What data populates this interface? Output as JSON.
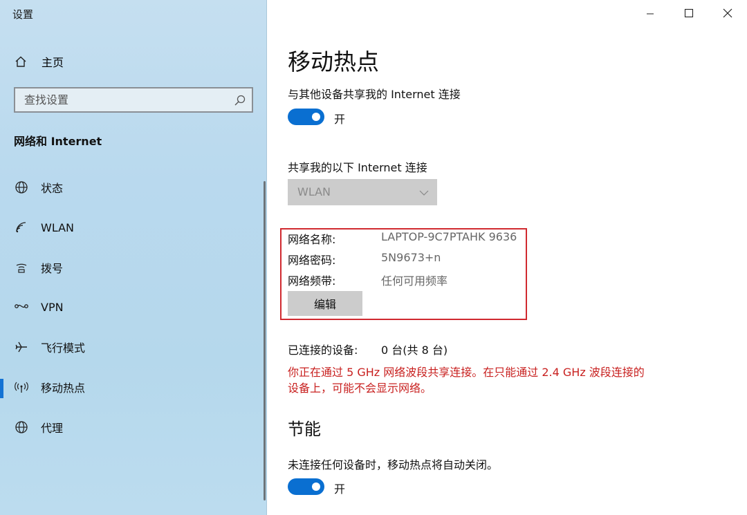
{
  "window": {
    "title": "设置",
    "controls": {
      "minimize": "minimize-icon",
      "maximize": "maximize-icon",
      "close": "close-icon"
    }
  },
  "sidebar": {
    "home_label": "主页",
    "search_placeholder": "查找设置",
    "section_title": "网络和 Internet",
    "items": [
      {
        "label": "状态",
        "icon": "globe-status-icon"
      },
      {
        "label": "WLAN",
        "icon": "wifi-icon"
      },
      {
        "label": "拨号",
        "icon": "dialup-icon"
      },
      {
        "label": "VPN",
        "icon": "vpn-icon"
      },
      {
        "label": "飞行模式",
        "icon": "airplane-icon"
      },
      {
        "label": "移动热点",
        "icon": "hotspot-icon",
        "selected": true
      },
      {
        "label": "代理",
        "icon": "globe-icon"
      }
    ]
  },
  "main": {
    "title": "移动热点",
    "share_label": "与其他设备共享我的 Internet 连接",
    "share_toggle_state": "开",
    "share_from_label": "共享我的以下 Internet 连接",
    "share_from_value": "WLAN",
    "network_name_label": "网络名称:",
    "network_name_value": "LAPTOP-9C7PTAHK 9636",
    "network_password_label": "网络密码:",
    "network_password_value": "5N9673+n",
    "network_band_label": "网络频带:",
    "network_band_value": "任何可用频率",
    "edit_button": "编辑",
    "connected_label": "已连接的设备:",
    "connected_value": "0 台(共 8 台)",
    "warning_line1": "你正在通过 5 GHz 网络波段共享连接。在只能通过 2.4 GHz 波段连接的",
    "warning_line2": "设备上，可能不会显示网络。",
    "power_saving_title": "节能",
    "power_saving_desc": "未连接任何设备时，移动热点将自动关闭。",
    "power_toggle_state": "开"
  },
  "colors": {
    "accent": "#0a6fd1",
    "highlight_border": "#d0292f",
    "warning_text": "#c8201f",
    "sidebar_bg": "#b9d9ee"
  }
}
